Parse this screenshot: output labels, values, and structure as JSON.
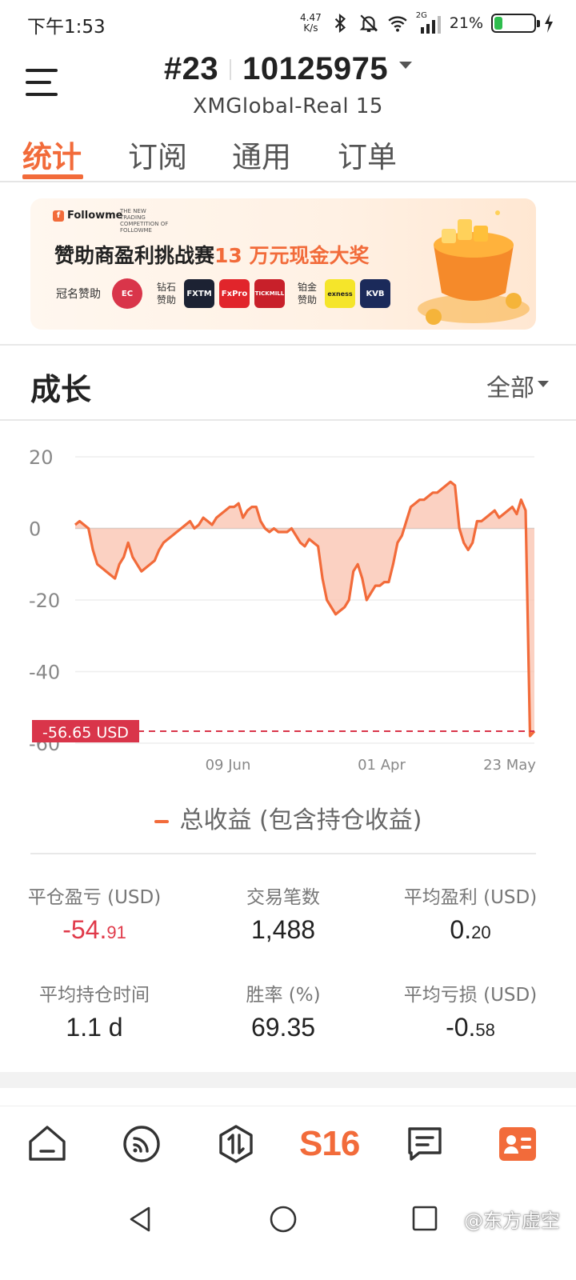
{
  "status_bar": {
    "time": "下午1:53",
    "net_speed_value": "4.47",
    "net_speed_unit": "K/s",
    "signal_label": "2G",
    "battery_pct": "21%",
    "battery_level": 0.21,
    "icons": [
      "bluetooth-icon",
      "mute-bell-icon",
      "wifi-icon",
      "cell-signal-icon",
      "battery-icon",
      "charging-icon"
    ]
  },
  "header": {
    "account_rank": "#23",
    "account_number": "10125975",
    "server": "XMGlobal-Real 15"
  },
  "tabs": [
    {
      "label": "统计",
      "active": true
    },
    {
      "label": "订阅",
      "active": false
    },
    {
      "label": "通用",
      "active": false
    },
    {
      "label": "订单",
      "active": false
    }
  ],
  "banner": {
    "brand": "Followme",
    "competition_caption": "THE NEW TRADING COMPETITION OF FOLLOWME",
    "title_prefix": "赞助商盈利挑战赛",
    "title_highlight": "13 万元现金大奖",
    "title_sponsor": "冠名赞助",
    "diamond_sponsor": "钻石赞助",
    "platinum_sponsor": "铂金赞助",
    "sponsor_logos": [
      "EC",
      "FXTM",
      "FxPro",
      "TICKMILL",
      "exness",
      "KVB"
    ]
  },
  "growth": {
    "title": "成长",
    "filter": "全部"
  },
  "chart_data": {
    "type": "area",
    "y_ticks": [
      "20",
      "0",
      "-20",
      "-40",
      "-60"
    ],
    "x_ticks": [
      "09 Jun",
      "01 Apr",
      "23 May"
    ],
    "ylim": [
      -60,
      20
    ],
    "current_value_label": "-56.65 USD",
    "current_value": -56.65,
    "legend": "总收益 (包含持仓收益)",
    "colors": {
      "line": "#f26b3a",
      "fill": "#f9c2ad",
      "marker": "#d9354a"
    },
    "values": [
      1,
      2,
      1,
      0,
      -6,
      -10,
      -11,
      -12,
      -13,
      -14,
      -10,
      -8,
      -4,
      -8,
      -10,
      -12,
      -11,
      -10,
      -9,
      -6,
      -4,
      -3,
      -2,
      -1,
      0,
      1,
      2,
      0,
      1,
      3,
      2,
      1,
      3,
      4,
      5,
      6,
      6,
      7,
      3,
      5,
      6,
      6,
      2,
      0,
      -1,
      0,
      -1,
      -1,
      -1,
      0,
      -2,
      -4,
      -5,
      -3,
      -4,
      -5,
      -14,
      -20,
      -22,
      -24,
      -23,
      -22,
      -20,
      -12,
      -10,
      -14,
      -20,
      -18,
      -16,
      -16,
      -15,
      -15,
      -10,
      -4,
      -2,
      2,
      6,
      7,
      8,
      8,
      9,
      10,
      10,
      11,
      12,
      13,
      12,
      0,
      -4,
      -6,
      -4,
      2,
      2,
      3,
      4,
      5,
      3,
      4,
      5,
      6,
      4,
      8,
      5,
      -58,
      -56.65
    ]
  },
  "stats": [
    {
      "label": "平仓盈亏 (USD)",
      "value_main": "-54.",
      "value_small": "91",
      "negative": true
    },
    {
      "label": "交易笔数",
      "value_main": "1,488",
      "value_small": "",
      "negative": false
    },
    {
      "label": "平均盈利 (USD)",
      "value_main": "0.",
      "value_small": "20",
      "negative": false
    },
    {
      "label": "平均持仓时间",
      "value_main": "1.1 d",
      "value_small": "",
      "negative": false
    },
    {
      "label": "胜率 (%)",
      "value_main": "69.35",
      "value_small": "",
      "negative": false
    },
    {
      "label": "平均亏损 (USD)",
      "value_main": "-0.",
      "value_small": "58",
      "negative": false
    }
  ],
  "bottom_nav": {
    "center_label": "S16",
    "items": [
      "home-icon",
      "feed-icon",
      "trade-icon",
      "s16-logo",
      "message-icon",
      "profile-card-icon"
    ]
  },
  "watermark": "@东方虚空"
}
